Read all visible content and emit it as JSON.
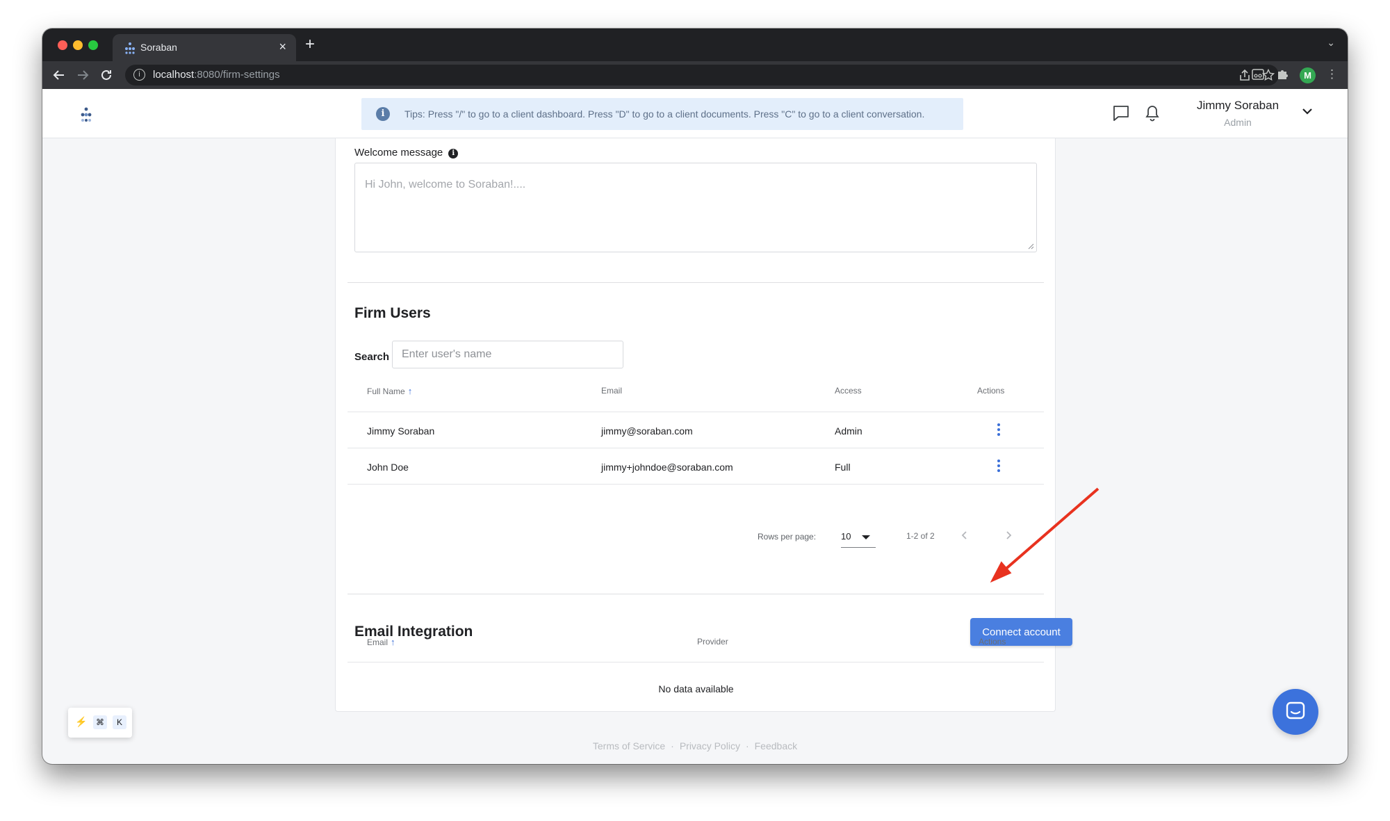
{
  "browser": {
    "tab_title": "Soraban",
    "tab_close": "×",
    "new_tab": "+",
    "tab_menu": "⌄",
    "url_host": "localhost",
    "url_path": ":8080/firm-settings",
    "profile_initial": "M"
  },
  "header": {
    "tips": "Tips: Press \"/\" to go to a client dashboard. Press \"D\" to go to a client documents. Press \"C\" to go to a client conversation.",
    "user_name": "Jimmy Soraban",
    "user_role": "Admin"
  },
  "welcome": {
    "label": "Welcome message",
    "placeholder": "Hi John, welcome to Soraban!...."
  },
  "firm_users": {
    "title": "Firm Users",
    "search_label": "Search",
    "search_placeholder": "Enter user's name",
    "columns": {
      "name": "Full Name",
      "email": "Email",
      "access": "Access",
      "actions": "Actions"
    },
    "rows": [
      {
        "name": "Jimmy Soraban",
        "email": "jimmy@soraban.com",
        "access": "Admin"
      },
      {
        "name": "John Doe",
        "email": "jimmy+johndoe@soraban.com",
        "access": "Full"
      }
    ],
    "pagination": {
      "rows_per_page_label": "Rows per page:",
      "rows_per_page": "10",
      "range": "1-2 of 2"
    }
  },
  "email_integration": {
    "title": "Email Integration",
    "connect_label": "Connect account",
    "columns": {
      "email": "Email",
      "provider": "Provider",
      "actions": "Actions"
    },
    "empty": "No data available"
  },
  "footer": {
    "terms": "Terms of Service",
    "privacy": "Privacy Policy",
    "feedback": "Feedback",
    "separator": "·"
  },
  "shortcut_bar": {
    "bolt": "⚡",
    "key_cmd": "⌘",
    "key_k": "K"
  },
  "colors": {
    "accent": "#4a7fe0",
    "annotation_arrow": "#e8321f",
    "tips_bg": "#e3eefb"
  },
  "icons": [
    "back-arrow-icon",
    "forward-arrow-icon",
    "reload-icon",
    "info-icon",
    "share-icon",
    "star-icon",
    "extension-icon",
    "puzzle-icon",
    "chat-icon",
    "bell-icon",
    "chevron-down-icon",
    "sort-up-icon",
    "kebab-menu-icon",
    "chevron-left-icon",
    "chevron-right-icon",
    "intercom-icon"
  ]
}
